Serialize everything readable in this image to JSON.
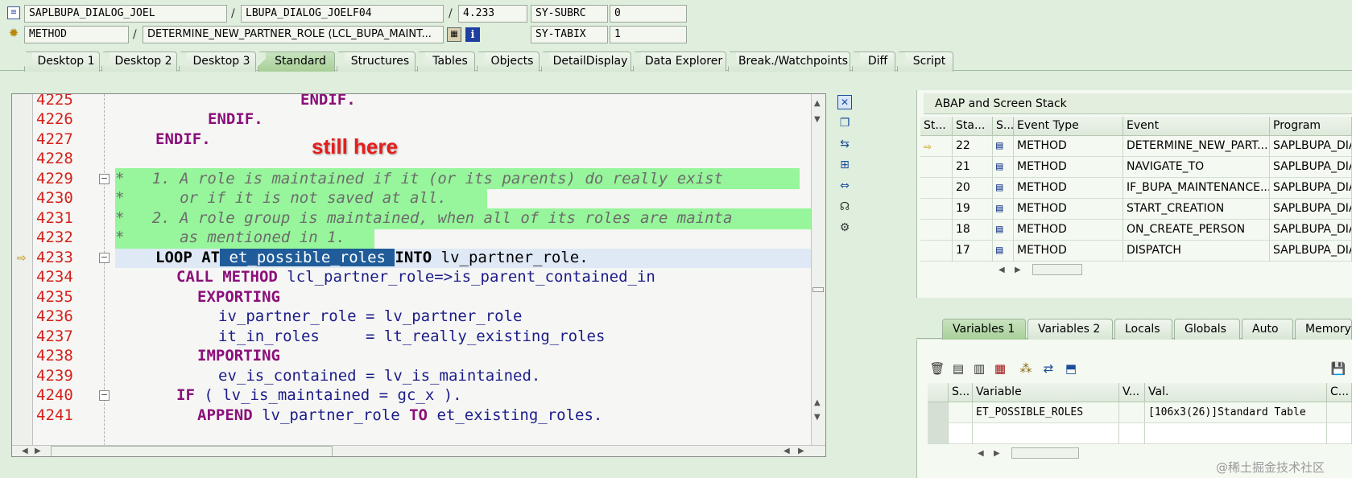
{
  "header": {
    "program_main": "SAPLBUPA_DIALOG_JOEL",
    "include_name": "LBUPA_DIALOG_JOELF04",
    "line_ref": "4.233",
    "sys_field_1_name": "SY-SUBRC",
    "sys_field_1_value": "0",
    "event_type": "METHOD",
    "event_name": "DETERMINE_NEW_PARTNER_ROLE (LCL_BUPA_MAINT...",
    "sys_field_2_name": "SY-TABIX",
    "sys_field_2_value": "1"
  },
  "tabs": [
    {
      "label": "Desktop 1"
    },
    {
      "label": "Desktop 2"
    },
    {
      "label": "Desktop 3"
    },
    {
      "label": "Standard"
    },
    {
      "label": "Structures"
    },
    {
      "label": "Tables"
    },
    {
      "label": "Objects"
    },
    {
      "label": "DetailDisplay"
    },
    {
      "label": "Data Explorer"
    },
    {
      "label": "Break./Watchpoints"
    },
    {
      "label": "Diff"
    },
    {
      "label": "Script"
    }
  ],
  "editor": {
    "annotation": "still here",
    "lines": [
      {
        "num": "4225"
      },
      {
        "num": "4226"
      },
      {
        "num": "4227"
      },
      {
        "num": "4228"
      },
      {
        "num": "4229"
      },
      {
        "num": "4230"
      },
      {
        "num": "4231"
      },
      {
        "num": "4232"
      },
      {
        "num": "4233"
      },
      {
        "num": "4234"
      },
      {
        "num": "4235"
      },
      {
        "num": "4236"
      },
      {
        "num": "4237"
      },
      {
        "num": "4238"
      },
      {
        "num": "4239"
      },
      {
        "num": "4240"
      },
      {
        "num": "4241"
      }
    ],
    "code": {
      "l4225": "ENDIF.",
      "l4226": "ENDIF.",
      "l4227": "ENDIF.",
      "l4229": "*   1. A role is maintained if it (or its parents) do really exist",
      "l4230": "*      or if it is not saved at all.",
      "l4231": "*   2. A role group is maintained, when all of its roles are mainta",
      "l4232": "*      as mentioned in 1.",
      "l4233_kw1": "LOOP AT",
      "l4233_sel": " et_possible_roles ",
      "l4233_kw2": "INTO",
      "l4233_rest": " lv_partner_role.",
      "l4234_kw": "CALL METHOD",
      "l4234_rest": " lcl_partner_role=>is_parent_contained_in",
      "l4235": "EXPORTING",
      "l4236": "iv_partner_role = lv_partner_role",
      "l4237": "it_in_roles     = lt_really_existing_roles",
      "l4238": "IMPORTING",
      "l4239": "ev_is_contained = lv_is_maintained.",
      "l4240_kw": "IF",
      "l4240_rest": " ( lv_is_maintained = gc_x ).",
      "l4241_kw1": "APPEND",
      "l4241_mid": " lv_partner_role ",
      "l4241_kw2": "TO",
      "l4241_rest": " et_existing_roles."
    }
  },
  "stack": {
    "title": "ABAP and Screen Stack",
    "columns": [
      "St...",
      "Sta...",
      "S...",
      "Event Type",
      "Event",
      "Program"
    ],
    "rows": [
      {
        "level": "22",
        "type": "METHOD",
        "event": "DETERMINE_NEW_PART...",
        "program": "SAPLBUPA_DIA",
        "current": true
      },
      {
        "level": "21",
        "type": "METHOD",
        "event": "NAVIGATE_TO",
        "program": "SAPLBUPA_DIA"
      },
      {
        "level": "20",
        "type": "METHOD",
        "event": "IF_BUPA_MAINTENANCE...",
        "program": "SAPLBUPA_DIA"
      },
      {
        "level": "19",
        "type": "METHOD",
        "event": "START_CREATION",
        "program": "SAPLBUPA_DIA"
      },
      {
        "level": "18",
        "type": "METHOD",
        "event": "ON_CREATE_PERSON",
        "program": "SAPLBUPA_DIA"
      },
      {
        "level": "17",
        "type": "METHOD",
        "event": "DISPATCH",
        "program": "SAPLBUPA_DIA"
      }
    ]
  },
  "variables": {
    "tabs": [
      {
        "label": "Variables 1"
      },
      {
        "label": "Variables 2"
      },
      {
        "label": "Locals"
      },
      {
        "label": "Globals"
      },
      {
        "label": "Auto"
      },
      {
        "label": "Memory"
      }
    ],
    "columns": [
      "S...",
      "Variable",
      "V...",
      "Val.",
      "C..."
    ],
    "rows": [
      {
        "variable": "ET_POSSIBLE_ROLES",
        "value": "[106x3(26)]Standard Table"
      }
    ]
  },
  "watermark": "@稀土掘金技术社区",
  "colors": {
    "accent_green": "#a7cf98",
    "comment_bg": "#97f59b",
    "selected_bg": "#1f5c99",
    "current_line_bg": "#dfe8f5"
  }
}
